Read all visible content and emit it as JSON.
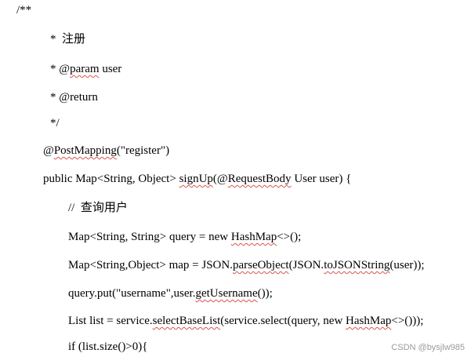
{
  "code": {
    "l1": "/**",
    "l2": "*  注册",
    "l3": {
      "prefix": "* @",
      "squiggle": "param",
      "suffix": " user"
    },
    "l4": "* @return",
    "l5": "*/",
    "l6": {
      "prefix": "@",
      "squiggle": "PostMapping",
      "suffix": "(\"register\")"
    },
    "l7": {
      "a": "public Map<String, Object> ",
      "s1": "signUp",
      "b": "(@",
      "s2": "RequestBody",
      "c": " User user) {"
    },
    "l8": "//  查询用户",
    "l9": {
      "a": "Map<String, String> query = new ",
      "s1": "HashMap",
      "b": "<>();"
    },
    "l10": {
      "a": "Map<String,Object> map = JSON.",
      "s1": "parseObject",
      "b": "(JSON.",
      "s2": "toJSONString",
      "c": "(user));"
    },
    "l11": {
      "a": "query.put(\"username\",user.",
      "s1": "getUsername",
      "b": "());"
    },
    "l12": {
      "a": "List list = service.",
      "s1": "selectBaseList",
      "b": "(service.select(query, new ",
      "s2": "HashMap",
      "c": "<>()));"
    },
    "l13": "if (list.size()>0){"
  },
  "watermark": "CSDN @bysjlw985",
  "colors": {
    "text": "#000000",
    "squiggle": "#d9534f",
    "watermark": "#9a9a9a"
  }
}
